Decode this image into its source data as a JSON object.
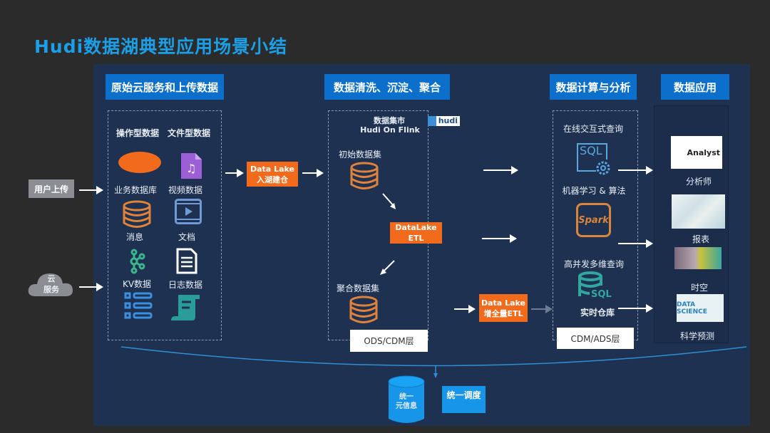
{
  "title": "Hudi数据湖典型应用场景小结",
  "headers": [
    "原始云服务和上传数据",
    "数据清洗、沉淀、聚合",
    "数据计算与分析",
    "数据应用"
  ],
  "inputs": {
    "upload": "用户上传",
    "cloud_line1": "云",
    "cloud_line2": "服务"
  },
  "sources": {
    "col_ops": "操作型数据",
    "col_files": "文件型数据",
    "items": [
      "业务数据库",
      "视频数据",
      "消息",
      "文档",
      "KV数据",
      "日志数据"
    ]
  },
  "ingest": {
    "line1": "Data Lake",
    "line2": "入湖建仓"
  },
  "cleaning": {
    "mart_title": "数据集市",
    "mart_subtitle": "Hudi  On Flink",
    "logo": "hudi",
    "initial": "初始数据集",
    "etl_line1": "DataLake",
    "etl_line2": "ETL",
    "aggregate": "聚合数据集",
    "layer": "ODS/CDM层"
  },
  "incr_etl": {
    "line1": "Data Lake",
    "line2": "增全量ETL"
  },
  "compute": {
    "interactive": "在线交互式查询",
    "sql_icon": "SQL",
    "ml": "机器学习 & 算法",
    "spark_icon": "Spark",
    "olap": "高并发多维查询",
    "sql_db": "SQL",
    "realtime": "实时仓库",
    "layer": "CDM/ADS层"
  },
  "apps": {
    "analyst_img": "Analyst",
    "analyst": "分析师",
    "report": "报表",
    "spatial": "时空",
    "ds_img": "DATA SCIENCE",
    "science": "科学预测"
  },
  "bottom": {
    "meta_line1": "统一",
    "meta_line2": "元信息",
    "schedule": "统一调度"
  },
  "colors": {
    "accent": "#1b9fe6",
    "header": "#0b6fcb",
    "orange": "#f26b1d",
    "panel": "#1e3150"
  }
}
